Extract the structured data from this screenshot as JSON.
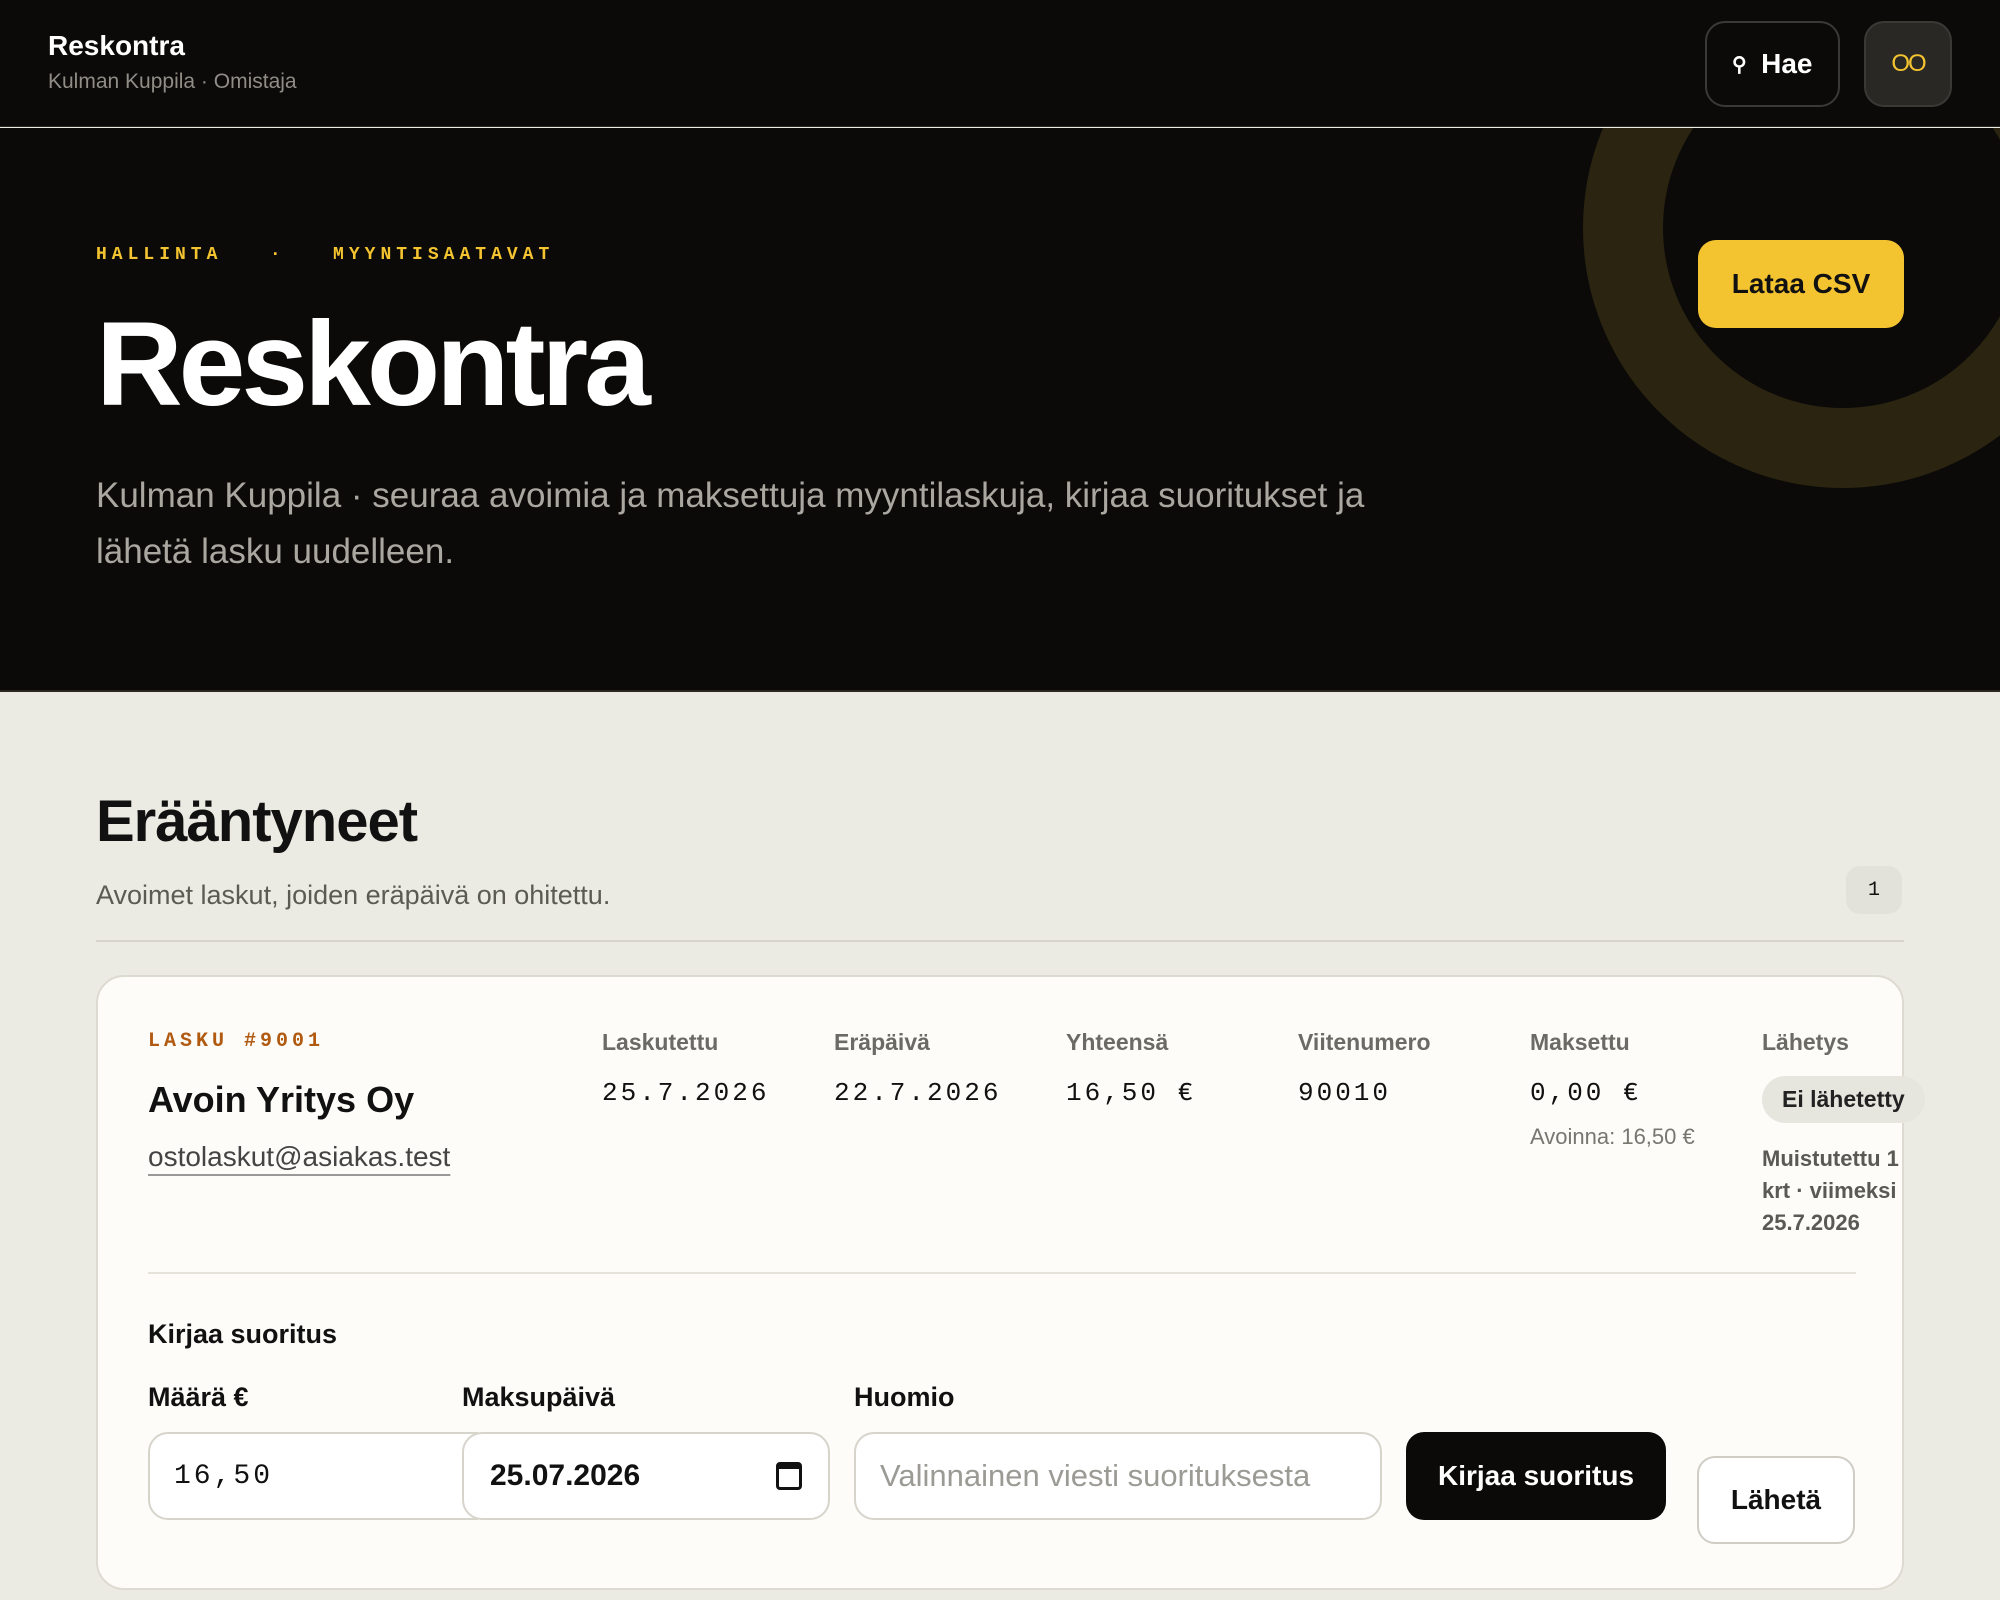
{
  "app": {
    "title": "Reskontra",
    "subtitle": "Kulman Kuppila · Omistaja",
    "search_label": "Hae",
    "search_icon": "search-icon",
    "avatar_initials": "OO"
  },
  "hero": {
    "breadcrumb_1": "HALLINTA",
    "breadcrumb_sep": "·",
    "breadcrumb_2": "MYYNTISAATAVAT",
    "title": "Reskontra",
    "description": "Kulman Kuppila · seuraa avoimia ja maksettuja myyntilaskuja, kirjaa suoritukset ja lähetä lasku uudelleen.",
    "csv_button": "Lataa CSV"
  },
  "section": {
    "title": "Erääntyneet",
    "subtitle": "Avoimet laskut, joiden eräpäivä on ohitettu.",
    "count": "1"
  },
  "invoice": {
    "label": "LASKU #9001",
    "customer": "Avoin Yritys Oy",
    "email": "ostolaskut@asiakas.test",
    "columns": {
      "invoiced_label": "Laskutettu",
      "invoiced_value": "25.7.2026",
      "due_label": "Eräpäivä",
      "due_value": "22.7.2026",
      "total_label": "Yhteensä",
      "total_value": "16,50 €",
      "reference_label": "Viitenumero",
      "reference_value": "90010",
      "paid_label": "Maksettu",
      "paid_value": "0,00 €",
      "open_note": "Avoinna: 16,50 €",
      "sending_label": "Lähetys",
      "sending_status": "Ei lähetetty",
      "reminder_note": "Muistutettu 1 krt · viimeksi 25.7.2026"
    },
    "payment_form": {
      "title": "Kirjaa suoritus",
      "amount_label": "Määrä €",
      "amount_value": "16,50",
      "date_label": "Maksupäivä",
      "date_value": "25.07.2026",
      "note_label": "Huomio",
      "note_placeholder": "Valinnainen viesti suorituksesta",
      "submit_button": "Kirjaa suoritus",
      "send_button": "Lähetä"
    }
  },
  "colors": {
    "accent": "#f4c430",
    "dark_bg": "#0b0a08",
    "page_bg": "#ecebe3",
    "invoice_label": "#b05a12"
  }
}
